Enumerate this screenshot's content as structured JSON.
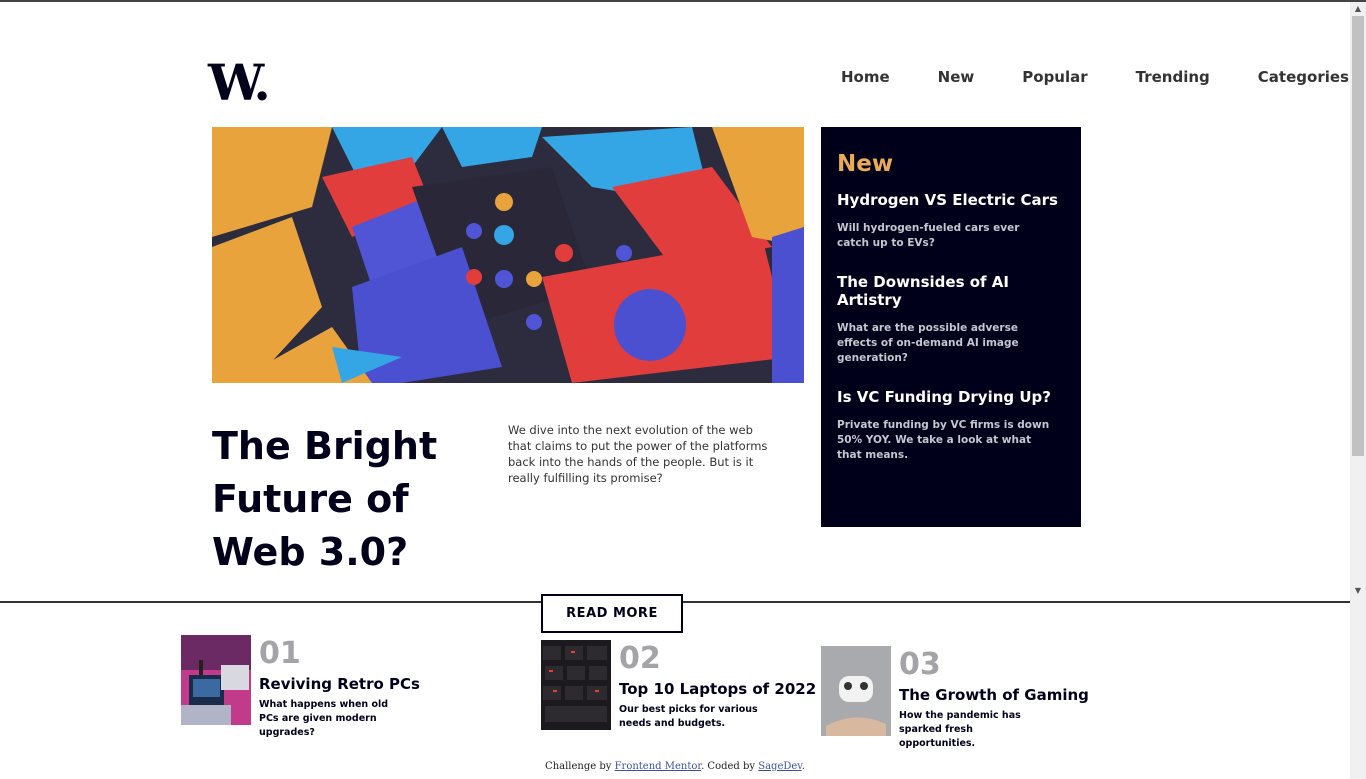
{
  "logo": "W.",
  "nav": [
    "Home",
    "New",
    "Popular",
    "Trending",
    "Categories"
  ],
  "hero": {
    "title": "The Bright Future of Web 3.0?",
    "description": "We dive into the next evolution of the web that claims to put the power of the platforms back into the hands of the people. But is it really fulfilling its promise?",
    "button": "READ MORE"
  },
  "new_section": {
    "heading": "New",
    "items": [
      {
        "title": "Hydrogen VS Electric Cars",
        "text": "Will hydrogen-fueled cars ever catch up to EVs?"
      },
      {
        "title": "The Downsides of AI Artistry",
        "text": "What are the possible adverse effects of on-demand AI image generation?"
      },
      {
        "title": "Is VC Funding Drying Up?",
        "text": "Private funding by VC firms is down 50% YOY. We take a look at what that means."
      }
    ]
  },
  "articles": [
    {
      "num": "01",
      "title": "Reviving Retro PCs",
      "text": "What happens when old PCs are given modern upgrades?"
    },
    {
      "num": "02",
      "title": "Top 10 Laptops of 2022",
      "text": "Our best picks for various needs and budgets."
    },
    {
      "num": "03",
      "title": "The Growth of Gaming",
      "text": "How the pandemic has sparked fresh opportunities."
    }
  ],
  "footer": {
    "prefix": "Challenge by ",
    "link1": "Frontend Mentor",
    "middle": ". Coded by ",
    "link2": "SageDev",
    "suffix": "."
  },
  "colors": {
    "dark": "#00001a",
    "accent": "#e9ab53",
    "muted": "#a3a3a8"
  }
}
